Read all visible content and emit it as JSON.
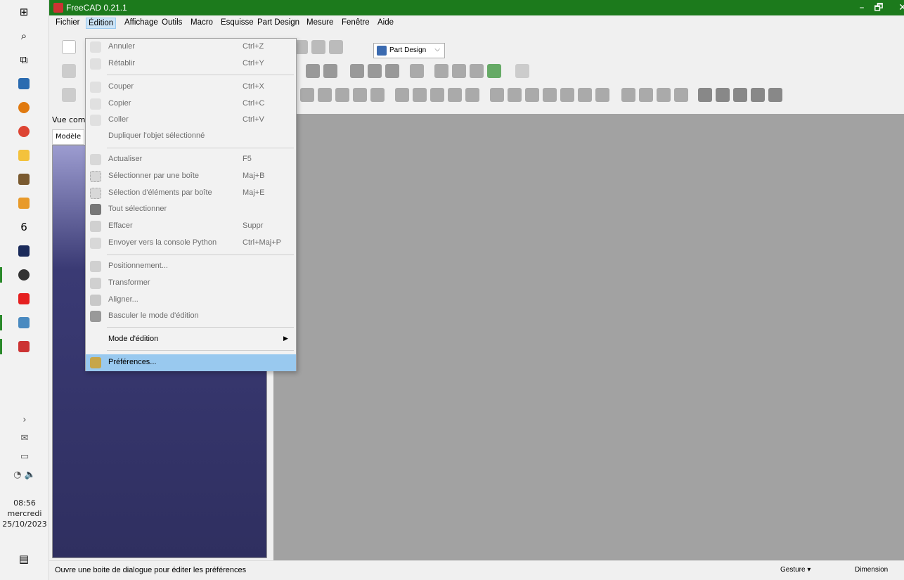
{
  "window": {
    "title": "FreeCAD 0.21.1",
    "minimize": "–",
    "maximize": "🗗",
    "close": "✕"
  },
  "menubar": [
    "Fichier",
    "Édition",
    "Affichage",
    "Outils",
    "Macro",
    "Esquisse",
    "Part Design",
    "Mesure",
    "Fenêtre",
    "Aide"
  ],
  "toolbar": {
    "workbench": "Part Design"
  },
  "combo": {
    "title": "Vue com",
    "tab": "Modèle"
  },
  "edit_menu": {
    "annuler": {
      "label": "Annuler",
      "shortcut": "Ctrl+Z"
    },
    "retablir": {
      "label": "Rétablir",
      "shortcut": "Ctrl+Y"
    },
    "couper": {
      "label": "Couper",
      "shortcut": "Ctrl+X"
    },
    "copier": {
      "label": "Copier",
      "shortcut": "Ctrl+C"
    },
    "coller": {
      "label": "Coller",
      "shortcut": "Ctrl+V"
    },
    "dupliquer": {
      "label": "Dupliquer l'objet sélectionné"
    },
    "actualiser": {
      "label": "Actualiser",
      "shortcut": "F5"
    },
    "sel_boite": {
      "label": "Sélectionner par une boîte",
      "shortcut": "Maj+B"
    },
    "sel_elements": {
      "label": "Sélection d'éléments par boîte",
      "shortcut": "Maj+E"
    },
    "tout_sel": {
      "label": "Tout sélectionner"
    },
    "effacer": {
      "label": "Effacer",
      "shortcut": "Suppr"
    },
    "console": {
      "label": "Envoyer vers la console Python",
      "shortcut": "Ctrl+Maj+P"
    },
    "positionnement": {
      "label": "Positionnement..."
    },
    "transformer": {
      "label": "Transformer"
    },
    "aligner": {
      "label": "Aligner..."
    },
    "basculer": {
      "label": "Basculer le mode d'édition"
    },
    "mode_edition": {
      "label": "Mode d'édition"
    },
    "preferences": {
      "label": "Préférences..."
    }
  },
  "status": {
    "message": "Ouvre une boite de dialogue pour éditer les préférences",
    "gesture": "Gesture ▾",
    "dimension": "Dimension"
  },
  "clock": {
    "time": "08:56",
    "day": "mercredi",
    "date": "25/10/2023"
  },
  "colors": {
    "titlebar": "#1c7a1c",
    "highlight": "#99c9ef",
    "view3d": "#a2a2a2"
  }
}
